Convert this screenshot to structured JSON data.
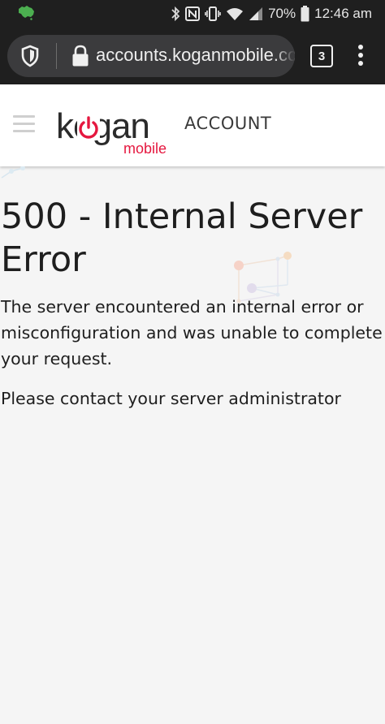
{
  "status_bar": {
    "battery": "70%",
    "time": "12:46 am",
    "icons": [
      "carrier-map-icon",
      "bluetooth-icon",
      "nfc-icon",
      "vibrate-icon",
      "wifi-icon",
      "signal-icon",
      "battery-icon"
    ]
  },
  "browser": {
    "url": "accounts.koganmobile.com",
    "tab_count": "3",
    "icons": [
      "shield-icon",
      "lock-icon",
      "menu-dots-icon"
    ]
  },
  "header": {
    "logo_word": "kogan",
    "logo_sub": "mobile",
    "section_label": "ACCOUNT",
    "brand_color": "#e5173f",
    "icons": [
      "hamburger-menu-icon"
    ]
  },
  "content": {
    "title": "500 - Internal Server Error",
    "description": "The server encountered an internal error or misconfiguration and was unable to complete your request.",
    "contact": "Please contact your server administrator"
  },
  "colors": {
    "page_background": "#f5f5f5",
    "browser_chrome": "#1f1f1f",
    "omnibox": "#3b3b3d"
  }
}
